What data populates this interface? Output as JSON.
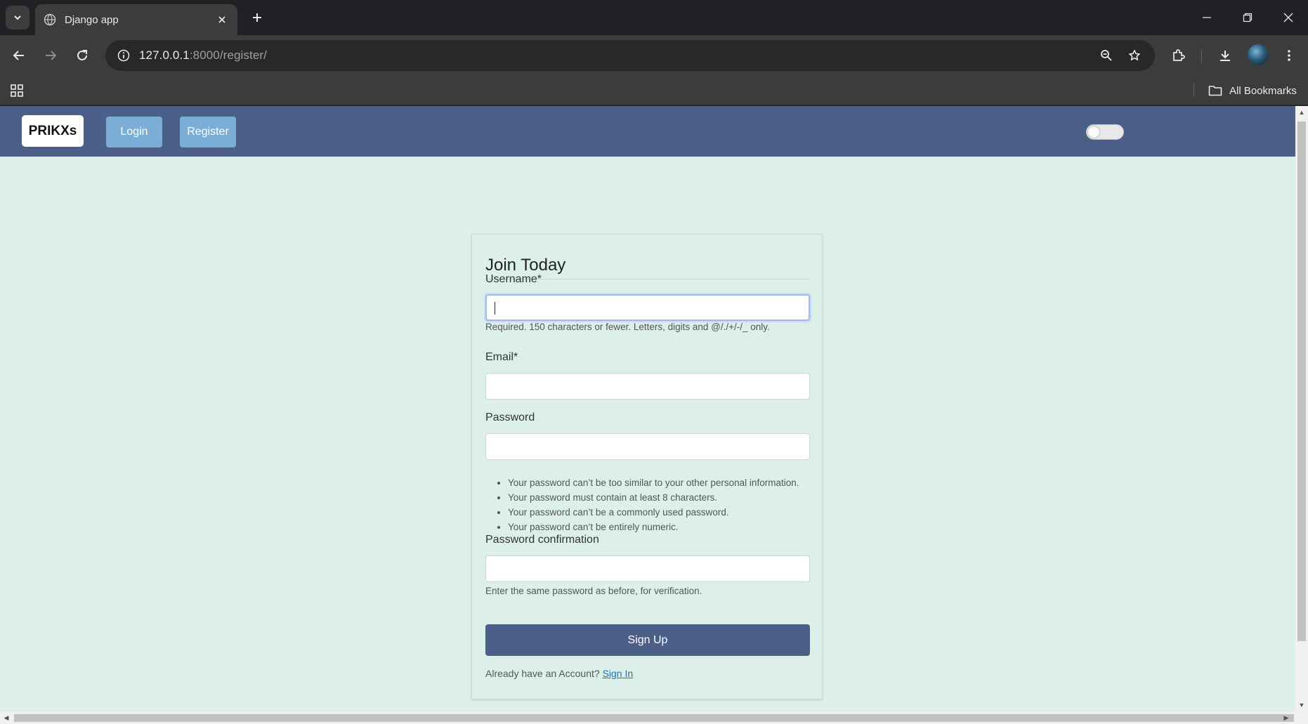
{
  "browser": {
    "tab_title": "Django app",
    "url_host": "127.0.0.1",
    "url_rest": ":8000/register/",
    "bookmarks_label": "All Bookmarks"
  },
  "site": {
    "brand": "PRIKXs",
    "nav": {
      "login": "Login",
      "register": "Register"
    },
    "theme_toggle_on": false
  },
  "form": {
    "title": "Join Today",
    "username_label": "Username*",
    "username_value": "",
    "username_help": "Required. 150 characters or fewer. Letters, digits and @/./+/-/_ only.",
    "email_label": "Email*",
    "email_value": "",
    "password_label": "Password",
    "password_value": "",
    "password_rules": [
      "Your password can’t be too similar to your other personal information.",
      "Your password must contain at least 8 characters.",
      "Your password can’t be a commonly used password.",
      "Your password can’t be entirely numeric."
    ],
    "password2_label": "Password confirmation",
    "password2_value": "",
    "password2_help": "Enter the same password as before, for verification.",
    "submit": "Sign Up",
    "already_text": "Already have an Account?",
    "signin_link": "Sign In"
  },
  "colors": {
    "navbar": "#4b5f88",
    "page_bg": "#ddf0ea",
    "nav_button": "#7aaed6",
    "link": "#1a6fd1"
  }
}
